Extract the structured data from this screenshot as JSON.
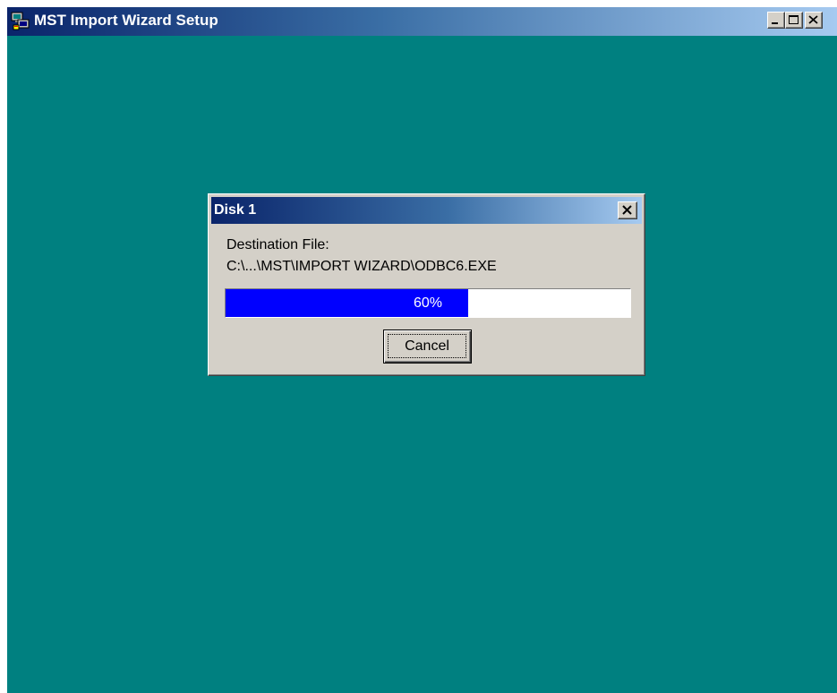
{
  "window": {
    "title": "MST Import Wizard Setup",
    "icon": "setup-computer-icon",
    "minimize_icon": "minimize-icon",
    "maximize_icon": "maximize-icon",
    "close_icon": "close-icon"
  },
  "desktop": {
    "background_color": "#008080"
  },
  "dialog": {
    "title": "Disk 1",
    "close_icon": "close-icon",
    "destination_label": "Destination File:",
    "destination_path": "C:\\...\\MST\\IMPORT WIZARD\\ODBC6.EXE",
    "progress": {
      "percent": 60,
      "text": "60%",
      "fill_color": "#0000ff"
    },
    "cancel_label": "Cancel"
  },
  "colors": {
    "titlebar_start": "#0a246a",
    "titlebar_end": "#a6caf0",
    "chrome": "#d4d0c8"
  }
}
